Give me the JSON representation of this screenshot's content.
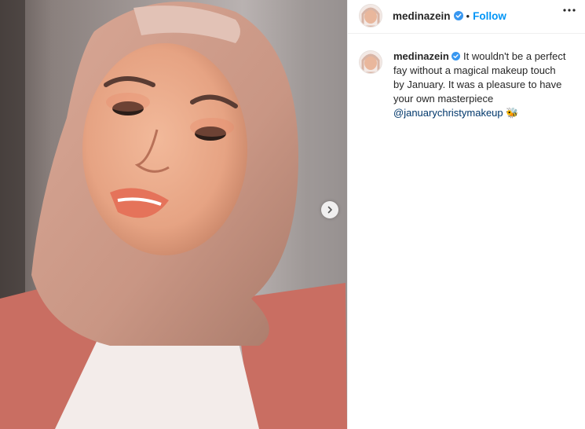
{
  "post": {
    "username": "medinazein",
    "separator": "•",
    "follow_label": "Follow",
    "caption_text": "It wouldn't be a perfect fay without a magical makeup touch by January. It was a pleasure to have your own masterpiece",
    "caption_mention": "@januarychristymakeup",
    "caption_emoji": "🐝"
  },
  "icons": {
    "verified": "verified-badge-icon",
    "more": "more-options-icon",
    "next": "chevron-right-icon"
  },
  "colors": {
    "follow": "#0095f6",
    "verified": "#3897f0",
    "mention": "#00376b"
  }
}
